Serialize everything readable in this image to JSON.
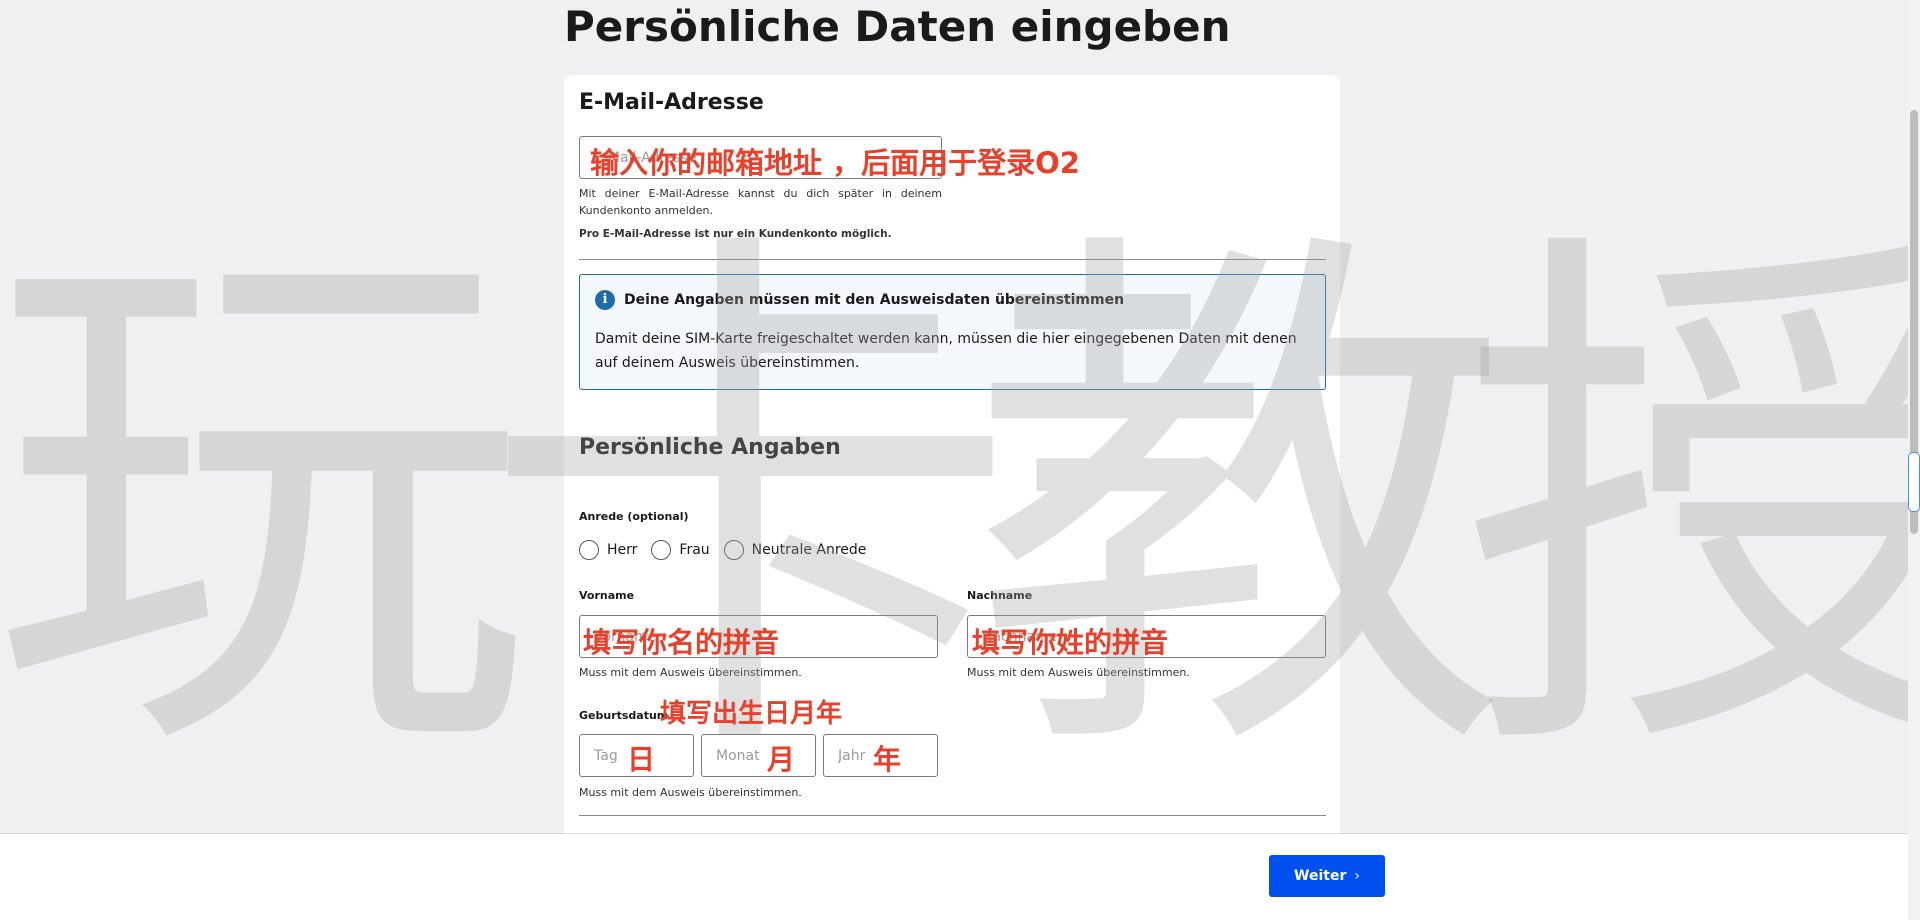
{
  "page": {
    "title": "Persönliche Daten eingeben"
  },
  "watermark": {
    "text": "玩卡教授"
  },
  "email_section": {
    "title": "E-Mail-Adresse",
    "input_placeholder": "E-Mail-Adresse",
    "hint": "Mit deiner E-Mail-Adresse kannst du dich später in deinem Kundenkonto anmelden.",
    "note": "Pro E-Mail-Adresse ist nur ein Kundenkonto möglich."
  },
  "info_box": {
    "icon": "info-icon",
    "title": "Deine Angaben müssen mit den Ausweisdaten übereinstimmen",
    "text": "Damit deine SIM-Karte freigeschaltet werden kann, müssen die hier eingegebenen Daten mit denen auf deinem Ausweis übereinstimmen."
  },
  "personal_section": {
    "title": "Persönliche Angaben",
    "salutation_label": "Anrede (optional)",
    "salutation_options": [
      "Herr",
      "Frau",
      "Neutrale Anrede"
    ],
    "firstname_label": "Vorname",
    "firstname_placeholder": "Vorname",
    "lastname_label": "Nachname",
    "lastname_placeholder": "Nachname",
    "match_hint": "Muss mit dem Ausweis übereinstimmen.",
    "birthdate_label": "Geburtsdatum",
    "day_placeholder": "Tag",
    "month_placeholder": "Monat",
    "year_placeholder": "Jahr"
  },
  "annotations": {
    "email": "输入你的邮箱地址 ，后面用于登录O2",
    "firstname": "填写你名的拼音",
    "lastname": "填写你姓的拼音",
    "birthdate": "填写出生日月年",
    "day": "日",
    "month": "月",
    "year": "年",
    "color": "#e8402b"
  },
  "footer": {
    "next_label": "Weiter",
    "next_icon": "chevron-right-icon",
    "accent": "#0050f0"
  }
}
